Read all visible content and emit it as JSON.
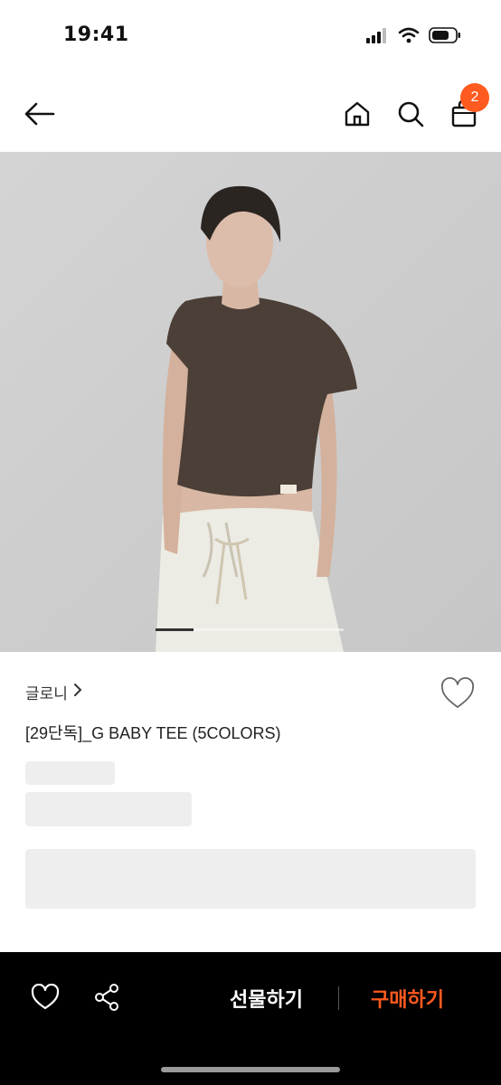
{
  "status": {
    "time": "19:41"
  },
  "header": {
    "cart_count": "2"
  },
  "product": {
    "brand": "글로니",
    "name": "[29단독]_G BABY TEE (5COLORS)"
  },
  "gallery": {
    "current_index_fraction": 0.2
  },
  "actions": {
    "gift_label": "선물하기",
    "buy_label": "구매하기"
  },
  "colors": {
    "accent": "#ff5a1f",
    "bottom_bar": "#000000"
  }
}
